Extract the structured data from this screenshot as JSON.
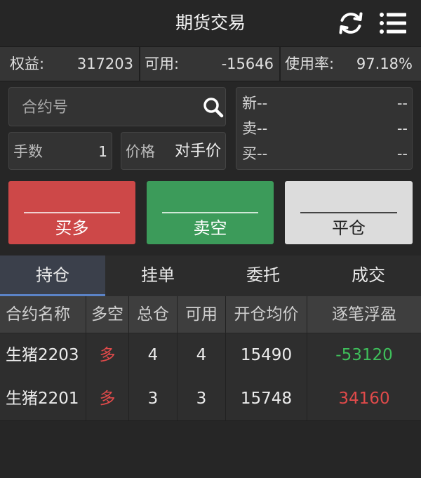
{
  "header": {
    "title": "期货交易"
  },
  "account": {
    "equity_label": "权益:",
    "equity_value": "317203",
    "available_label": "可用:",
    "available_value": "-15646",
    "usage_label": "使用率:",
    "usage_value": "97.18%"
  },
  "order_form": {
    "contract_placeholder": "合约号",
    "lots_label": "手数",
    "lots_value": "1",
    "price_label": "价格",
    "price_value": "对手价"
  },
  "quote": {
    "rows": [
      {
        "label": "新--",
        "value": "--"
      },
      {
        "label": "卖--",
        "value": "--"
      },
      {
        "label": "买--",
        "value": "--"
      }
    ]
  },
  "actions": {
    "buy_long": "买多",
    "sell_short": "卖空",
    "close": "平仓"
  },
  "tabs": [
    "持仓",
    "挂单",
    "委托",
    "成交"
  ],
  "table": {
    "headers": [
      "合约名称",
      "多空",
      "总仓",
      "可用",
      "开仓均价",
      "逐笔浮盈"
    ],
    "rows": [
      {
        "name": "生猪2203",
        "direction": "多",
        "total": "4",
        "available": "4",
        "avg_price": "15490",
        "pnl": "-53120"
      },
      {
        "name": "生猪2201",
        "direction": "多",
        "total": "3",
        "available": "3",
        "avg_price": "15748",
        "pnl": "34160"
      }
    ]
  },
  "colors": {
    "buy": "#cd4848",
    "sell": "#3c9b5a",
    "profit": "#e04a4a",
    "loss": "#3fbf5b",
    "active_tab": "#5b83c7"
  },
  "icons": {
    "refresh": "refresh-icon",
    "menu": "menu-icon",
    "search": "search-icon"
  }
}
